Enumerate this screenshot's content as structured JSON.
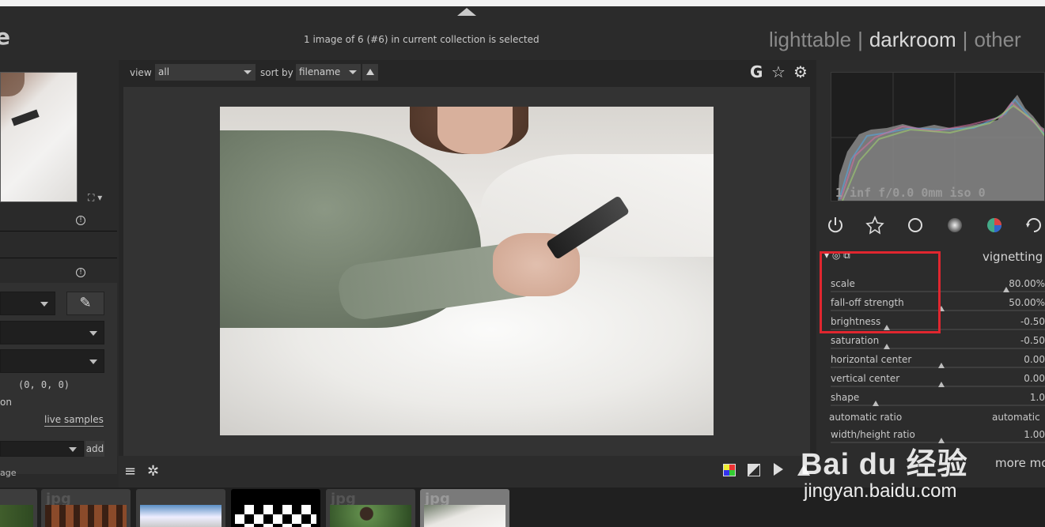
{
  "header": {
    "logo_fragment": "e",
    "status": "1 image of 6 (#6) in current collection is selected",
    "views": [
      {
        "label": "lighttable",
        "state": "inactive"
      },
      {
        "label": "darkroom",
        "state": "active"
      },
      {
        "label": "other",
        "state": "inactive"
      }
    ],
    "separator": "|"
  },
  "toolbar": {
    "view_label": "view",
    "view_value": "all",
    "sort_label": "sort by",
    "sort_value": "filename",
    "icons": [
      "grouping-g-icon",
      "star-icon",
      "gear-icon"
    ],
    "g_glyph": "G"
  },
  "left_panel": {
    "rgb_readout": "(0, 0, 0)",
    "on_fragment": "on",
    "live_samples": "live samples",
    "add_label": "add",
    "image_fragment": "age"
  },
  "histogram": {
    "exif": "1/inf f/0.0 0mm iso 0"
  },
  "module": {
    "title": "vignetting",
    "sliders": [
      {
        "label": "scale",
        "value": "80.00%",
        "position": 0.8
      },
      {
        "label": "fall-off strength",
        "value": "50.00%",
        "position": 0.5
      },
      {
        "label": "brightness",
        "value": "-0.50",
        "position": 0.25
      },
      {
        "label": "saturation",
        "value": "-0.50",
        "position": 0.25
      },
      {
        "label": "horizontal center",
        "value": "0.00",
        "position": 0.5
      },
      {
        "label": "vertical center",
        "value": "0.00",
        "position": 0.5
      },
      {
        "label": "shape",
        "value": "1.0",
        "position": 0.2
      },
      {
        "label": "width/height ratio",
        "value": "1.00",
        "position": 0.5
      }
    ],
    "auto_ratio_label": "automatic ratio",
    "auto_ratio_value": "automatic"
  },
  "more_modules": "more mo",
  "filmstrip": {
    "ext_label": "jpg"
  },
  "watermark": {
    "main": "Bai du 经验",
    "sub": "jingyan.baidu.com"
  },
  "colors": {
    "highlight_box": "#e0262f",
    "background": "#262626"
  }
}
